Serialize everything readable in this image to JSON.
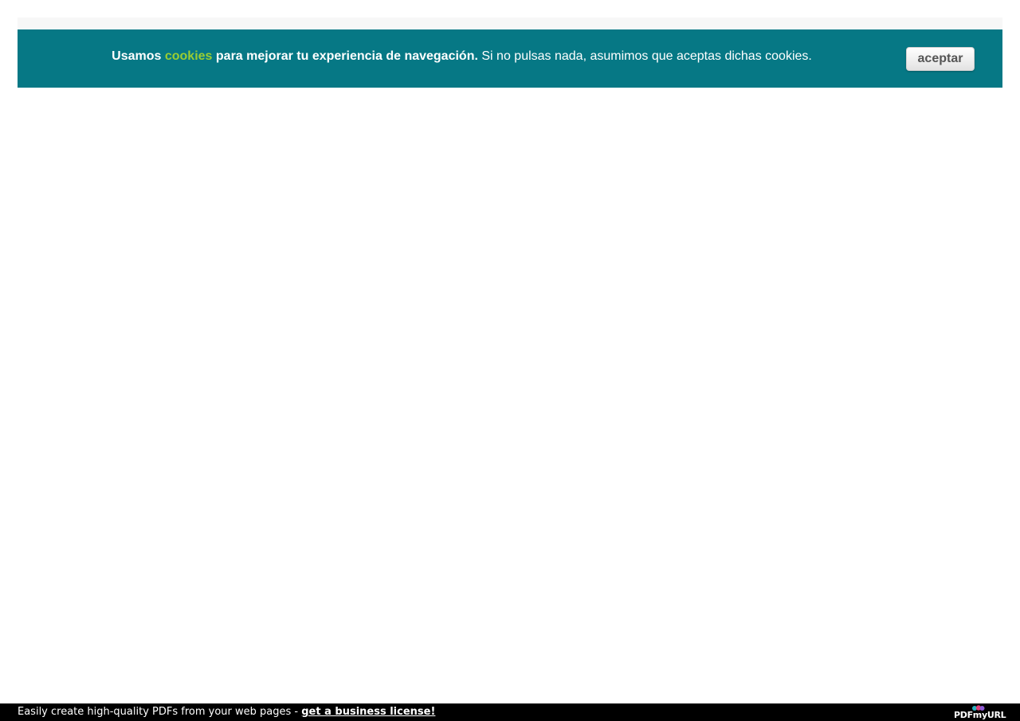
{
  "cookie_banner": {
    "bold_prefix": "Usamos",
    "cookies_link": "cookies",
    "bold_suffix": "para mejorar tu experiencia de navegación.",
    "message": "Si no pulsas nada, asumimos que aceptas dichas cookies.",
    "accept_label": "aceptar",
    "background_color": "#067885",
    "link_color": "#9acd32"
  },
  "footer": {
    "text": "Easily create high-quality PDFs from your web pages - ",
    "link": "get a business license!",
    "logo_text": "PDFmyURL"
  }
}
